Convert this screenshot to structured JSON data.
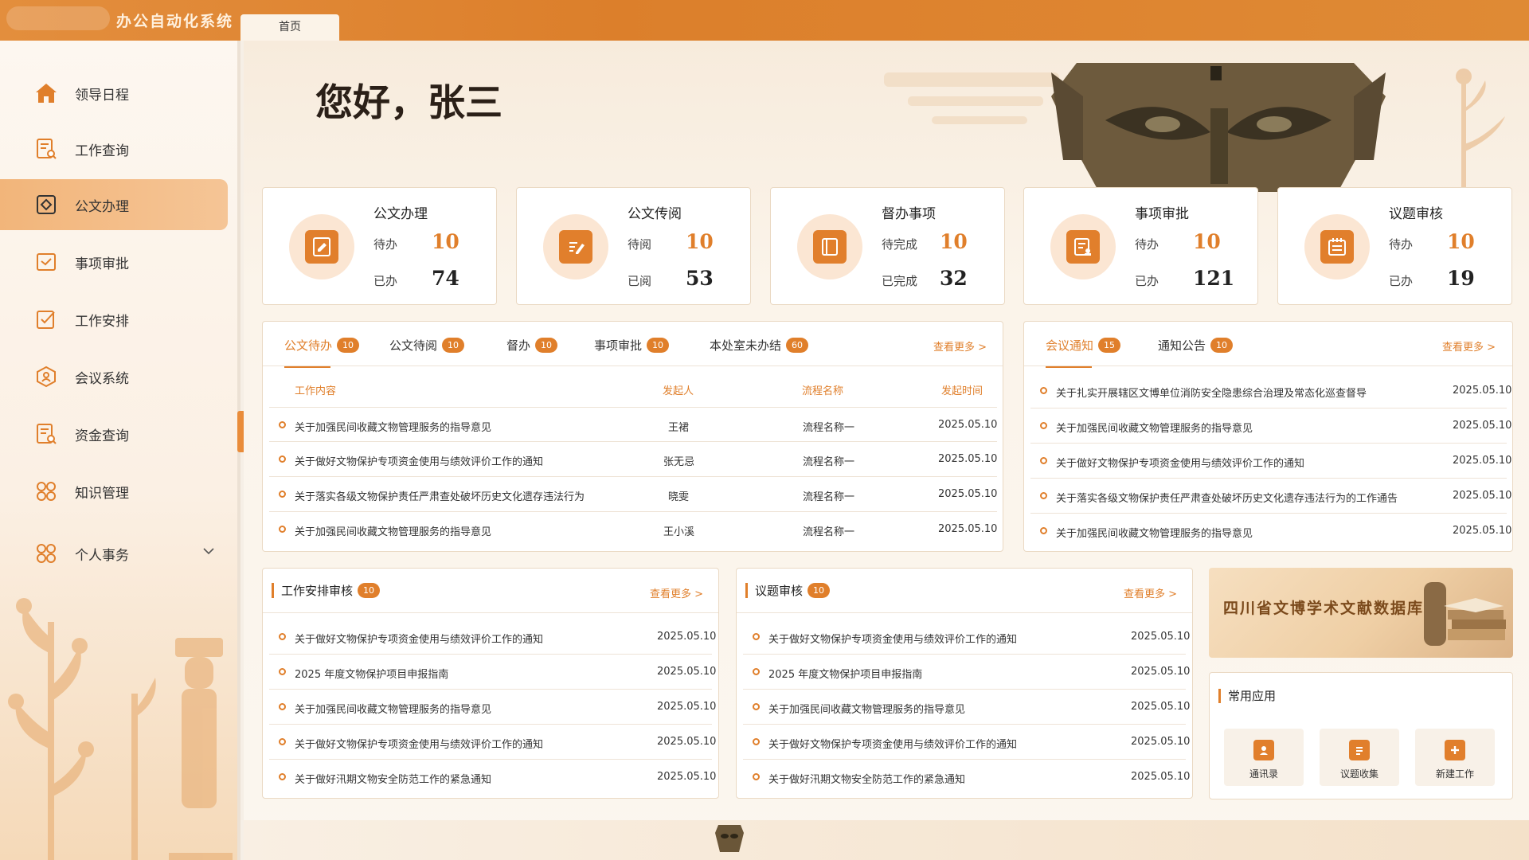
{
  "app": {
    "title": "办公自动化系统",
    "home_tab": "首页"
  },
  "sidebar": {
    "items": [
      {
        "label": "领导日程",
        "icon": "home-icon"
      },
      {
        "label": "工作查询",
        "icon": "document-search-icon"
      },
      {
        "label": "公文办理",
        "icon": "diamond-doc-icon",
        "active": true
      },
      {
        "label": "事项审批",
        "icon": "mail-check-icon"
      },
      {
        "label": "工作安排",
        "icon": "checklist-icon"
      },
      {
        "label": "会议系统",
        "icon": "meeting-icon"
      },
      {
        "label": "资金查询",
        "icon": "fund-search-icon"
      },
      {
        "label": "知识管理",
        "icon": "grid-icon"
      },
      {
        "label": "个人事务",
        "icon": "grid-icon",
        "expandable": true
      }
    ]
  },
  "greeting": "您好，张三",
  "cards": [
    {
      "title": "公文办理",
      "r1_label": "待办",
      "r1_value": "10",
      "r2_label": "已办",
      "r2_value": "74",
      "icon": "pen-document-icon"
    },
    {
      "title": "公文传阅",
      "r1_label": "待阅",
      "r1_value": "10",
      "r2_label": "已阅",
      "r2_value": "53",
      "icon": "edit-document-icon"
    },
    {
      "title": "督办事项",
      "r1_label": "待完成",
      "r1_value": "10",
      "r2_label": "已完成",
      "r2_value": "32",
      "icon": "book-icon"
    },
    {
      "title": "事项审批",
      "r1_label": "待办",
      "r1_value": "10",
      "r2_label": "已办",
      "r2_value": "121",
      "icon": "approval-icon"
    },
    {
      "title": "议题审核",
      "r1_label": "待办",
      "r1_value": "10",
      "r2_label": "已办",
      "r2_value": "19",
      "icon": "notepad-icon"
    }
  ],
  "doc_panel": {
    "tabs": [
      {
        "label": "公文待办",
        "count": "10"
      },
      {
        "label": "公文待阅",
        "count": "10"
      },
      {
        "label": "督办",
        "count": "10"
      },
      {
        "label": "事项审批",
        "count": "10"
      },
      {
        "label": "本处室未办结",
        "count": "60"
      }
    ],
    "more": "查看更多 >",
    "columns": [
      "工作内容",
      "发起人",
      "流程名称",
      "发起时间"
    ],
    "rows": [
      {
        "content": "关于加强民间收藏文物管理服务的指导意见",
        "initiator": "王裙",
        "flow": "流程名称一",
        "time": "2025.05.10"
      },
      {
        "content": "关于做好文物保护专项资金使用与绩效评价工作的通知",
        "initiator": "张无忌",
        "flow": "流程名称一",
        "time": "2025.05.10"
      },
      {
        "content": "关于落实各级文物保护责任严肃查处破坏历史文化遗存违法行为",
        "initiator": "晓雯",
        "flow": "流程名称一",
        "time": "2025.05.10"
      },
      {
        "content": "关于加强民间收藏文物管理服务的指导意见",
        "initiator": "王小溪",
        "flow": "流程名称一",
        "time": "2025.05.10"
      }
    ]
  },
  "notice_panel": {
    "tabs": [
      {
        "label": "会议通知",
        "count": "15"
      },
      {
        "label": "通知公告",
        "count": "10"
      }
    ],
    "more": "查看更多 >",
    "rows": [
      {
        "content": "关于扎实开展辖区文博单位消防安全隐患综合治理及常态化巡查督导",
        "time": "2025.05.10"
      },
      {
        "content": "关于加强民间收藏文物管理服务的指导意见",
        "time": "2025.05.10"
      },
      {
        "content": "关于做好文物保护专项资金使用与绩效评价工作的通知",
        "time": "2025.05.10"
      },
      {
        "content": "关于落实各级文物保护责任严肃查处破坏历史文化遗存违法行为的工作通告",
        "time": "2025.05.10"
      },
      {
        "content": "关于加强民间收藏文物管理服务的指导意见",
        "time": "2025.05.10"
      }
    ]
  },
  "work_panel": {
    "title": "工作安排审核",
    "count": "10",
    "more": "查看更多 >",
    "rows": [
      {
        "content": "关于做好文物保护专项资金使用与绩效评价工作的通知",
        "time": "2025.05.10"
      },
      {
        "content": "2025 年度文物保护项目申报指南",
        "time": "2025.05.10"
      },
      {
        "content": "关于加强民间收藏文物管理服务的指导意见",
        "time": "2025.05.10"
      },
      {
        "content": "关于做好文物保护专项资金使用与绩效评价工作的通知",
        "time": "2025.05.10"
      },
      {
        "content": "关于做好汛期文物安全防范工作的紧急通知",
        "time": "2025.05.10"
      }
    ]
  },
  "topic_panel": {
    "title": "议题审核",
    "count": "10",
    "more": "查看更多 >",
    "rows": [
      {
        "content": "关于做好文物保护专项资金使用与绩效评价工作的通知",
        "time": "2025.05.10"
      },
      {
        "content": "2025 年度文物保护项目申报指南",
        "time": "2025.05.10"
      },
      {
        "content": "关于加强民间收藏文物管理服务的指导意见",
        "time": "2025.05.10"
      },
      {
        "content": "关于做好文物保护专项资金使用与绩效评价工作的通知",
        "time": "2025.05.10"
      },
      {
        "content": "关于做好汛期文物安全防范工作的紧急通知",
        "time": "2025.05.10"
      }
    ]
  },
  "db_banner": {
    "text": "四川省文博学术文献数据库"
  },
  "common_apps": {
    "title": "常用应用",
    "items": [
      {
        "label": "通讯录",
        "icon": "contacts-icon"
      },
      {
        "label": "议题收集",
        "icon": "topic-collect-icon"
      },
      {
        "label": "新建工作",
        "icon": "new-work-icon"
      }
    ]
  },
  "colors": {
    "accent": "#e07f2b",
    "topbar": "#dc7f2b",
    "background": "#f6efe6"
  }
}
